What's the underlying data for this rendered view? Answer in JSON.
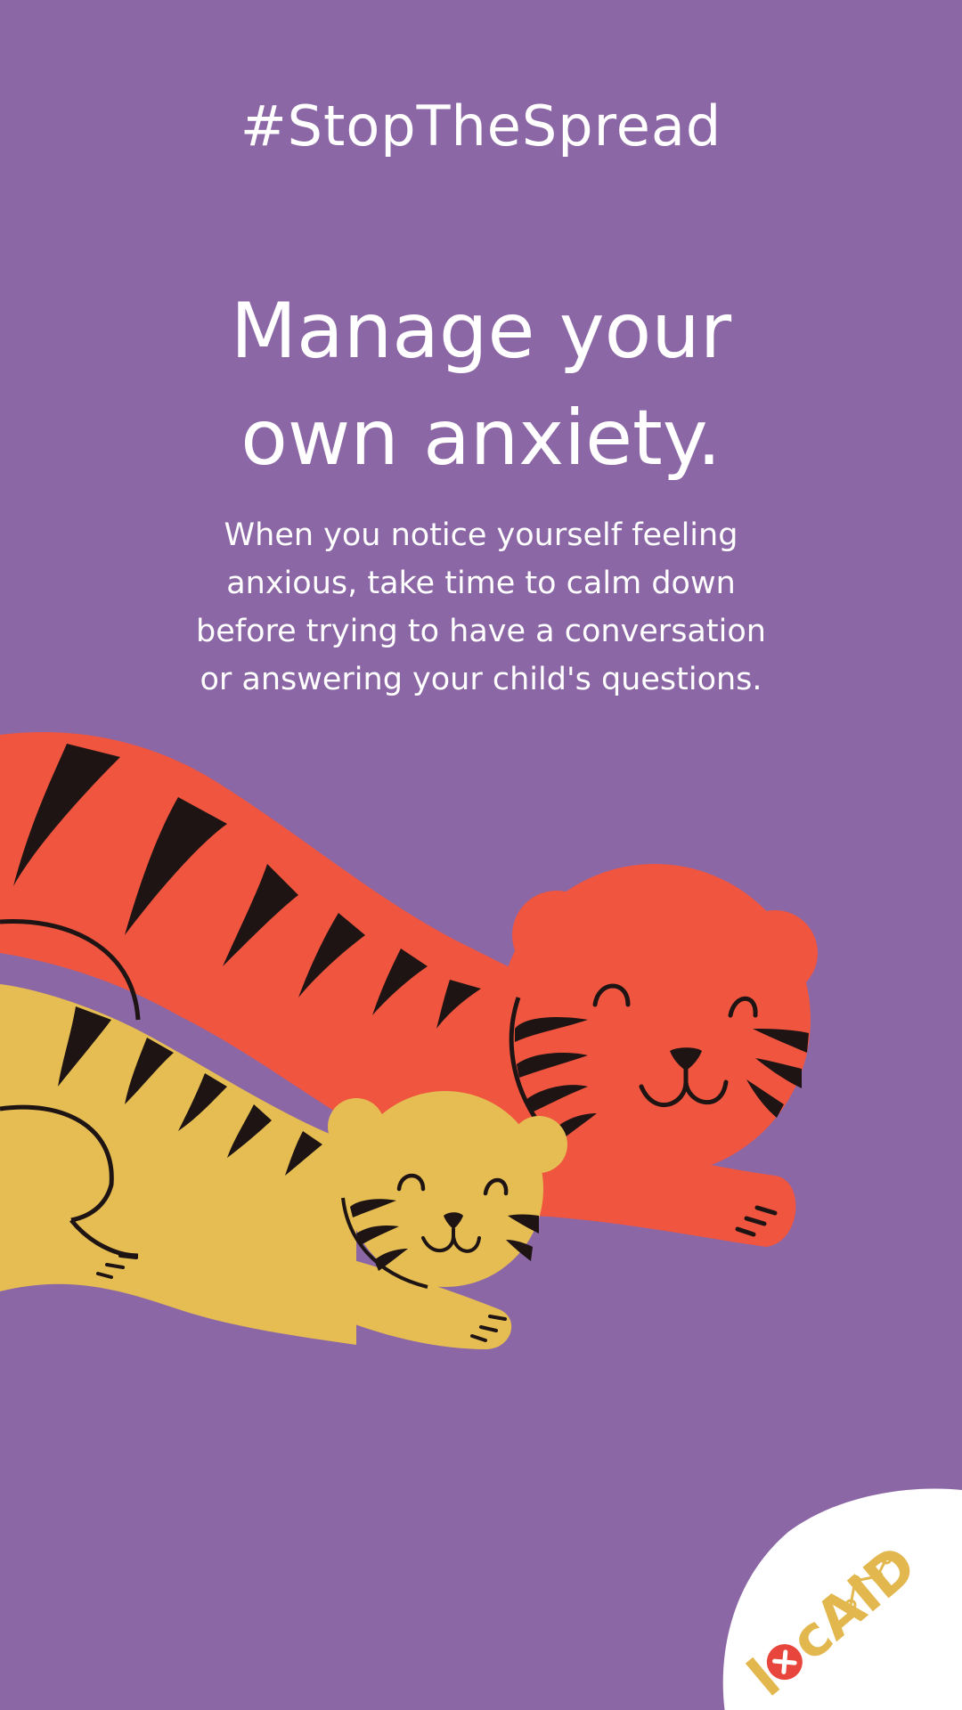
{
  "poster": {
    "hashtag": "#StopTheSpread",
    "headline_line1": "Manage your",
    "headline_line2": "own anxiety.",
    "body_line1": "When you notice yourself feeling",
    "body_line2": "anxious, take time to calm down",
    "body_line3": "before trying to have a conversation",
    "body_line4": "or answering your child's questions."
  },
  "logo": {
    "text": "locAID"
  },
  "colors": {
    "background": "#8c67a6",
    "big_tiger": "#f0553f",
    "small_tiger": "#e5bd52",
    "stripes": "#1e1414",
    "logo_gold": "#e2b84e",
    "logo_red": "#e8463c"
  },
  "icons": [
    "mother-tiger-illustration",
    "cub-tiger-illustration",
    "locaid-logo"
  ]
}
